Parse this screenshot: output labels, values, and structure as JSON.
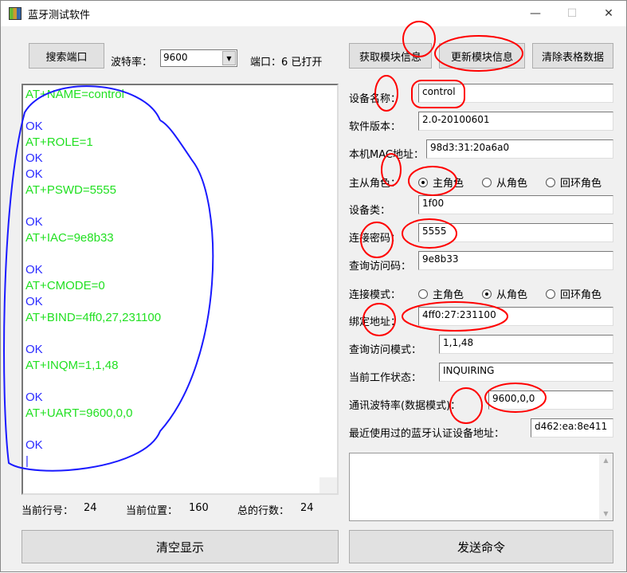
{
  "window": {
    "title": "蓝牙测试软件",
    "minimize": "—",
    "maximize": "☐",
    "close": "✕"
  },
  "toolbar": {
    "search_port": "搜索端口",
    "baud_label": "波特率：",
    "baud_value": "9600",
    "port_status": "端口：6 已打开"
  },
  "buttons": {
    "get_info": "获取模块信息",
    "update_info": "更新模块信息",
    "clear_table": "清除表格数据",
    "clear_display": "清空显示",
    "send_command": "发送命令"
  },
  "log": [
    {
      "t": "AT+NAME=control",
      "c": "g"
    },
    {
      "t": "",
      "c": "g"
    },
    {
      "t": "OK",
      "c": "b"
    },
    {
      "t": "AT+ROLE=1",
      "c": "g"
    },
    {
      "t": "OK",
      "c": "b"
    },
    {
      "t": "OK",
      "c": "b"
    },
    {
      "t": "AT+PSWD=5555",
      "c": "g"
    },
    {
      "t": "",
      "c": "g"
    },
    {
      "t": "OK",
      "c": "b"
    },
    {
      "t": "AT+IAC=9e8b33",
      "c": "g"
    },
    {
      "t": "",
      "c": "g"
    },
    {
      "t": "OK",
      "c": "b"
    },
    {
      "t": "AT+CMODE=0",
      "c": "g"
    },
    {
      "t": "OK",
      "c": "b"
    },
    {
      "t": "AT+BIND=4ff0,27,231100",
      "c": "g"
    },
    {
      "t": "",
      "c": "g"
    },
    {
      "t": "OK",
      "c": "b"
    },
    {
      "t": "AT+INQM=1,1,48",
      "c": "g"
    },
    {
      "t": "",
      "c": "g"
    },
    {
      "t": "OK",
      "c": "b"
    },
    {
      "t": "AT+UART=9600,0,0",
      "c": "g"
    },
    {
      "t": "",
      "c": "g"
    },
    {
      "t": "OK",
      "c": "b"
    },
    {
      "t": "|",
      "c": "b"
    }
  ],
  "status": {
    "line_label": "当前行号：",
    "line": "24",
    "pos_label": "当前位置：",
    "pos": "160",
    "total_label": "总的行数：",
    "total": "24"
  },
  "form": {
    "name_label": "设备名称：",
    "name": "control",
    "version_label": "软件版本：",
    "version": "2.0-20100601",
    "mac_label": "本机MAC地址：",
    "mac": "98d3:31:20a6a0",
    "role_label": "主从角色：",
    "role_options": [
      "主角色",
      "从角色",
      "回环角色"
    ],
    "role_selected": 0,
    "class_label": "设备类：",
    "class": "1f00",
    "pswd_label": "连接密码：",
    "pswd": "5555",
    "iac_label": "查询访问码：",
    "iac": "9e8b33",
    "cmode_label": "连接模式：",
    "cmode_options": [
      "主角色",
      "从角色",
      "回环角色"
    ],
    "cmode_selected": 1,
    "bind_label": "绑定地址：",
    "bind": "4ff0:27:231100",
    "inqm_label": "查询访问模式：",
    "inqm": "1,1,48",
    "state_label": "当前工作状态：",
    "state": "INQUIRING",
    "uart_label": "通讯波特率(数据模式)：",
    "uart": "9600,0,0",
    "recent_label": "最近使用过的蓝牙认证设备地址：",
    "recent": "d462:ea:8e411"
  }
}
